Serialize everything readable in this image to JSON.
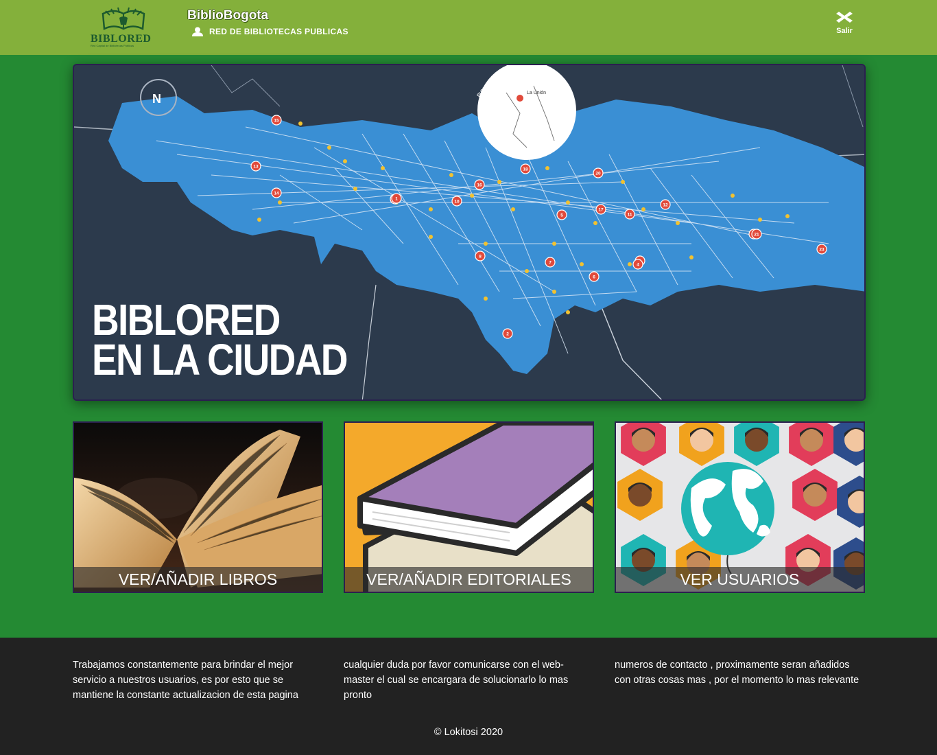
{
  "header": {
    "logo_text": "BIBLORED",
    "logo_subtitle": "Red Capital de Bibliotecas Públicas",
    "title": "BiblioBogota",
    "subtitle": "RED DE BIBLIOTECAS PUBLICAS",
    "logout_label": "Salir",
    "bg_color": "#84b03b"
  },
  "banner": {
    "line1": "BIBLORED",
    "line2": "EN LA CIUDAD",
    "inset_label": "La Unión",
    "inset_side_label": "SUMAPAZ",
    "compass_label": "N",
    "map_markers": [
      "13",
      "15",
      "14",
      "10",
      "9",
      "16",
      "18",
      "20",
      "12",
      "11",
      "17",
      "5",
      "19",
      "3",
      "8",
      "7",
      "6",
      "4",
      "2",
      "1",
      "21",
      "23"
    ]
  },
  "cards": [
    {
      "label": "VER/AÑADIR LIBROS"
    },
    {
      "label": "VER/AÑADIR EDITORIALES"
    },
    {
      "label": "VER USUARIOS"
    }
  ],
  "footer": {
    "col1": "Trabajamos constantemente para brindar el mejor servicio a nuestros usuarios, es por esto que se mantiene la constante actualizacion de esta pagina",
    "col2": "cualquier duda por favor comunicarse con el web-master el cual se encargara de solucionarlo lo mas pronto",
    "col3": "numeros de contacto , proximamente seran añadidos con otras cosas mas , por el momento lo mas relevante",
    "copyright": "© Lokitosi 2020"
  },
  "colors": {
    "page_bg": "#248a33",
    "footer_bg": "#222222",
    "map_blue": "#3a8fd4",
    "map_bg": "#2c3a4c"
  }
}
